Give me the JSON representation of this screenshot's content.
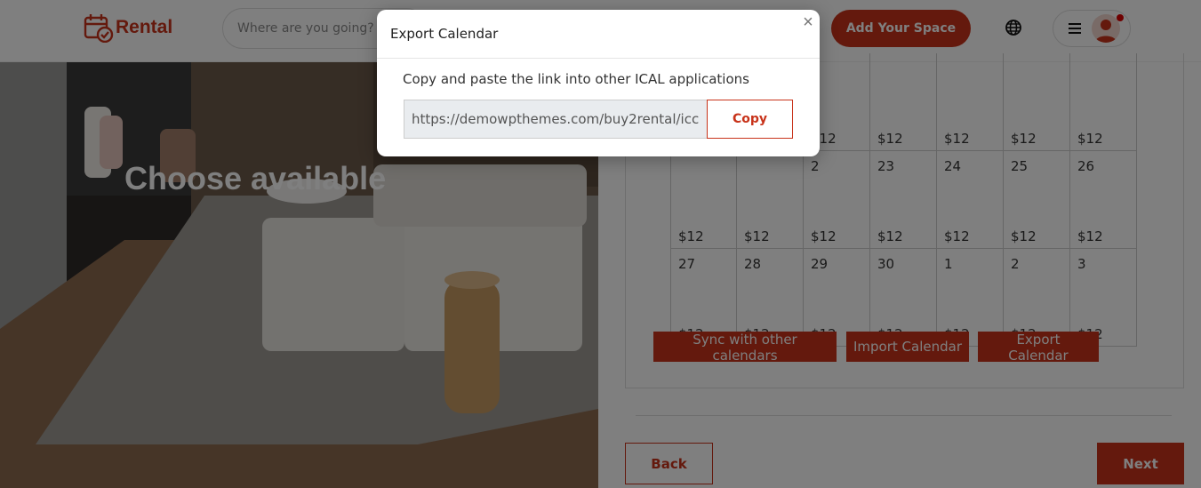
{
  "header": {
    "logo_text": "Rental",
    "search_placeholder": "Where are you going?",
    "add_space_label": "Add Your Space"
  },
  "hero": {
    "title": "Choose available"
  },
  "calendar": {
    "rows": [
      {
        "days": [
          "",
          "",
          "",
          "",
          "",
          "",
          ""
        ],
        "prices": [
          "",
          "",
          "$12",
          "$12",
          "$12",
          "$12",
          "$12"
        ]
      },
      {
        "days": [
          "",
          "",
          "2",
          "23",
          "24",
          "25",
          "26"
        ],
        "prices": [
          "$12",
          "$12",
          "$12",
          "$12",
          "$12",
          "$12",
          "$12"
        ]
      },
      {
        "days": [
          "27",
          "28",
          "29",
          "30",
          "1",
          "2",
          "3"
        ],
        "prices": [
          "$12",
          "$12",
          "$12",
          "$12",
          "$12",
          "$12",
          "$12"
        ]
      }
    ],
    "sync_label": "Sync with other calendars",
    "import_label": "Import Calendar",
    "export_label": "Export Calendar"
  },
  "nav": {
    "back_label": "Back",
    "next_label": "Next"
  },
  "modal": {
    "title": "Export Calendar",
    "close_symbol": "×",
    "description": "Copy and paste the link into other ICAL applications",
    "link_value": "https://demowpthemes.com/buy2rental/icc",
    "copy_label": "Copy"
  },
  "colors": {
    "accent": "#c8331a"
  }
}
